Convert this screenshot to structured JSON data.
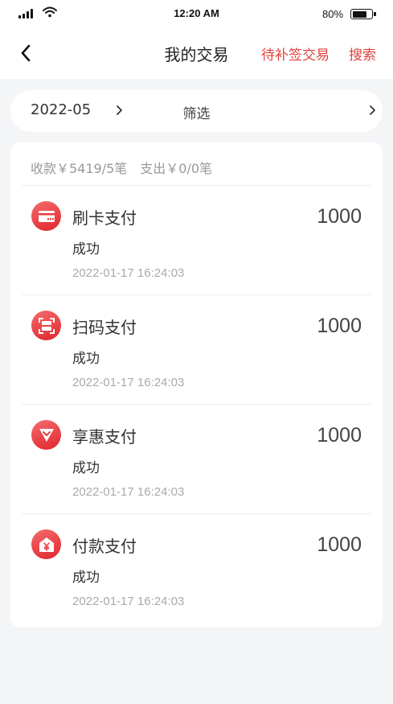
{
  "status_bar": {
    "time": "12:20 AM",
    "battery_percent": "80%",
    "battery_level": 0.8
  },
  "nav": {
    "title": "我的交易",
    "pending_link": "待补签交易",
    "search_link": "搜索"
  },
  "filter": {
    "month": "2022-05",
    "label": "筛选"
  },
  "summary": {
    "income": "收款￥5419/5笔",
    "expense": "支出￥0/0笔"
  },
  "transactions": [
    {
      "name": "刷卡支付",
      "amount": "1000",
      "status": "成功",
      "time": "2022-01-17 16:24:03",
      "icon": "card-payment-icon"
    },
    {
      "name": "扫码支付",
      "amount": "1000",
      "status": "成功",
      "time": "2022-01-17 16:24:03",
      "icon": "scan-payment-icon"
    },
    {
      "name": "享惠支付",
      "amount": "1000",
      "status": "成功",
      "time": "2022-01-17 16:24:03",
      "icon": "discount-payment-icon"
    },
    {
      "name": "付款支付",
      "amount": "1000",
      "status": "成功",
      "time": "2022-01-17 16:24:03",
      "icon": "yuan-payment-icon"
    }
  ],
  "colors": {
    "accent": "#e0433f",
    "icon_gradient_start": "#f46b6b",
    "icon_gradient_end": "#e0262f",
    "page_background": "#f4f5f7"
  }
}
